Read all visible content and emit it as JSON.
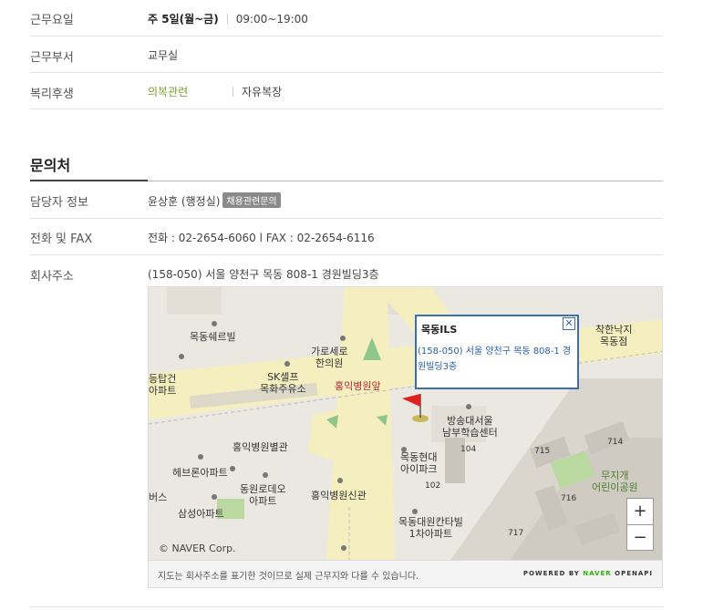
{
  "rows_top": [
    {
      "label": "근무요일",
      "parts": [
        "주 5일(월~금)",
        "09:00~19:00"
      ]
    },
    {
      "label": "근무부서",
      "parts": [
        "교무실"
      ]
    },
    {
      "label": "복리후생",
      "parts": [
        "의복관련",
        "자유복장"
      ]
    }
  ],
  "contact": {
    "title": "문의처",
    "manager": {
      "label": "담당자 정보",
      "value": "윤상훈 (행정실)",
      "badge": "채용관련문의"
    },
    "phone": {
      "label": "전화 및 FAX",
      "value": "전화 : 02-2654-6060 l FAX : 02-2654-6116"
    },
    "address": {
      "label": "회사주소",
      "value": "(158-050) 서울 양천구 목동 808-1 경원빌딩3층"
    }
  },
  "map": {
    "popup_title": "목동ILS",
    "popup_address": "(158-050) 서울 양천구 목동 808-1 경원빌딩3층",
    "close": "✕",
    "zoom_in": "+",
    "zoom_out": "−",
    "copyright": "© NAVER Corp.",
    "labels": {
      "l1": "목동쉐르빌",
      "l2": "가로세로\n한의원",
      "l3": "착한낙지\n목동점",
      "l4": "등탑건\n아파트",
      "l5": "SK셀프\n목화주유소",
      "l6": "홍익병원앞",
      "l7": "방송대서울\n남부학습센터",
      "l8": "홍익병원별관",
      "l9": "목동현대\n아이파크",
      "l10": "헤브론아파트",
      "l11": "동원로데오\n아파트",
      "l12": "홍익병원신관",
      "l13": "무지개\n어린이공원",
      "l14": "삼성아파트",
      "l15": "버스",
      "l16": "목동대원칸타빌\n1차아파트",
      "b1": "715",
      "b2": "714",
      "b3": "716",
      "b4": "717",
      "b5": "104",
      "b6": "102"
    },
    "footer_note": "지도는 회사주소를 표기한 것이므로 실제 근무지와 다를 수 있습니다.",
    "powered_prefix": "POWERED BY",
    "powered_brand": "NAVER",
    "powered_suffix": "OPENAPI"
  }
}
